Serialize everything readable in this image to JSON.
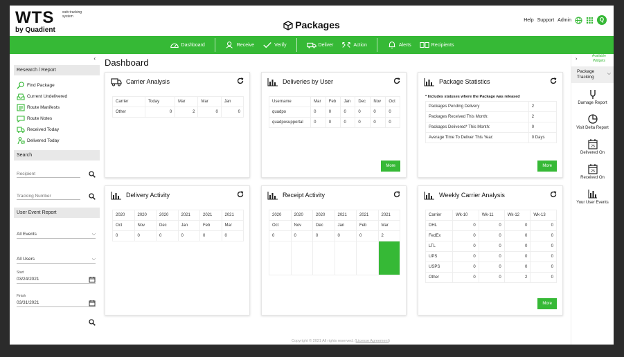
{
  "logo": {
    "wts": "WTS",
    "tagline": "web tracking system",
    "by": "by Quadient"
  },
  "app_title": "Packages",
  "toplinks": {
    "help": "Help",
    "support": "Support",
    "admin": "Admin",
    "avatar": "Q"
  },
  "nav": [
    {
      "group": [
        {
          "label": "Dashboard",
          "icon": "dashboard-gauge-icon"
        }
      ]
    },
    {
      "group": [
        {
          "label": "Receive",
          "icon": "receive-icon"
        },
        {
          "label": "Verify",
          "icon": "verify-icon"
        }
      ]
    },
    {
      "group": [
        {
          "label": "Deliver",
          "icon": "deliver-icon"
        },
        {
          "label": "Action",
          "icon": "action-icon"
        }
      ]
    },
    {
      "group": [
        {
          "label": "Alerts",
          "icon": "bell-icon"
        },
        {
          "label": "Recipients",
          "icon": "recipients-icon"
        }
      ]
    }
  ],
  "sidebar": {
    "collapse": "‹",
    "research_header": "Research / Report",
    "links": [
      "Find Package",
      "Current Undelivered",
      "Route Manifests",
      "Route Notes",
      "Received Today",
      "Delivered Today"
    ],
    "search_header": "Search",
    "recipient_placeholder": "Recipient",
    "tracking_placeholder": "Tracking Number",
    "event_header": "User Event Report",
    "events_select": "All Events",
    "users_select": "All Users",
    "start_label": "Start",
    "start_value": "03/24/2021",
    "finish_label": "Finish",
    "finish_value": "03/31/2021"
  },
  "main": {
    "title": "Dashboard",
    "footer_copyright": "Copyright © 2021 All rights reserved.",
    "footer_link": "License Agreement",
    "more": "More",
    "carrier_analysis": {
      "title": "Carrier Analysis",
      "headers": [
        "Carrier",
        "Today",
        "Mar",
        "Mar",
        "Jan"
      ],
      "rows": [
        [
          "Other",
          "0",
          "2",
          "0",
          "0"
        ]
      ]
    },
    "deliveries_by_user": {
      "title": "Deliveries by User",
      "headers": [
        "Username",
        "Mar",
        "Feb",
        "Jan",
        "Dec",
        "Nov",
        "Oct"
      ],
      "rows": [
        [
          "quadpo",
          "0",
          "0",
          "0",
          "0",
          "0",
          "0"
        ],
        [
          "quadposupportal",
          "0",
          "0",
          "0",
          "0",
          "0",
          "0"
        ]
      ]
    },
    "package_statistics": {
      "title": "Package Statistics",
      "note": "* Includes statuses where the Package was released",
      "rows": [
        [
          "Packages Pending Delivery",
          "2"
        ],
        [
          "Packages Received This Month:",
          "2"
        ],
        [
          "Packages Delivered* This Month:",
          "0"
        ],
        [
          "Average Time To Deliver This Year:",
          "0 Days"
        ]
      ]
    },
    "delivery_activity": {
      "title": "Delivery Activity",
      "years": [
        "2020",
        "2020",
        "2020",
        "2021",
        "2021",
        "2021"
      ],
      "months": [
        "Oct",
        "Nov",
        "Dec",
        "Jan",
        "Feb",
        "Mar"
      ],
      "values": [
        "0",
        "0",
        "0",
        "0",
        "0",
        "0"
      ]
    },
    "receipt_activity": {
      "title": "Receipt Activity",
      "years": [
        "2020",
        "2020",
        "2020",
        "2021",
        "2021",
        "2021"
      ],
      "months": [
        "Oct",
        "Nov",
        "Dec",
        "Jan",
        "Feb",
        "Mar"
      ],
      "values": [
        "0",
        "0",
        "0",
        "0",
        "0",
        "2"
      ],
      "bar_color": "#36b936"
    },
    "weekly_carrier": {
      "title": "Weekly Carrier Analysis",
      "headers": [
        "Carrier",
        "Wk-10",
        "Wk-11",
        "Wk-12",
        "Wk-13"
      ],
      "rows": [
        [
          "DHL",
          "0",
          "0",
          "0",
          "0"
        ],
        [
          "FedEx",
          "0",
          "0",
          "0",
          "0"
        ],
        [
          "LTL",
          "0",
          "0",
          "0",
          "0"
        ],
        [
          "UPS",
          "0",
          "0",
          "0",
          "0"
        ],
        [
          "USPS",
          "0",
          "0",
          "0",
          "0"
        ],
        [
          "Other",
          "0",
          "0",
          "2",
          "0"
        ]
      ]
    }
  },
  "widgets": {
    "expand": "›",
    "available": "Available Widgets",
    "package_tracking": "Package Tracking",
    "items": [
      "Damage Report",
      "Visit Delta Report",
      "Delivered On",
      "Received On",
      "Your User Events"
    ],
    "calendar_day": "25"
  },
  "colors": {
    "brand_green": "#36b936",
    "header_grey": "#e8e8e8"
  }
}
